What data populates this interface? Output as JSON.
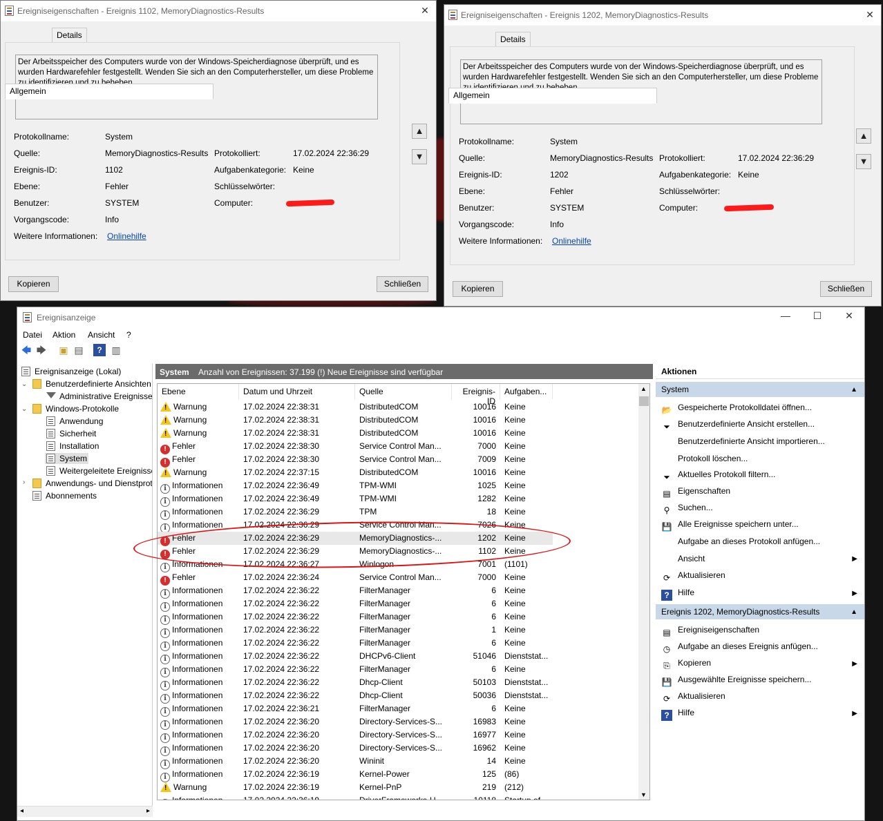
{
  "dialogs": [
    {
      "title": "Ereigniseigenschaften - Ereignis 1102, MemoryDiagnostics-Results",
      "tab_general": "Allgemein",
      "tab_details": "Details",
      "description": "Der Arbeitsspeicher des Computers wurde von der Windows-Speicherdiagnose überprüft, und es wurden Hardwarefehler festgestellt. Wenden Sie sich an den Computerhersteller, um diese Probleme zu identifizieren und zu beheben.",
      "fields": {
        "log_label": "Protokollname:",
        "log": "System",
        "source_label": "Quelle:",
        "source": "MemoryDiagnostics-Results",
        "logged_label": "Protokolliert:",
        "logged": "17.02.2024 22:36:29",
        "id_label": "Ereignis-ID:",
        "id": "1102",
        "task_label": "Aufgabenkategorie:",
        "task": "Keine",
        "level_label": "Ebene:",
        "level": "Fehler",
        "keywords_label": "Schlüsselwörter:",
        "user_label": "Benutzer:",
        "user": "SYSTEM",
        "computer_label": "Computer:",
        "opcode_label": "Vorgangscode:",
        "opcode": "Info",
        "more_label": "Weitere Informationen:",
        "more_link": "Onlinehilfe"
      },
      "copy": "Kopieren",
      "close": "Schließen"
    },
    {
      "title": "Ereigniseigenschaften - Ereignis 1202, MemoryDiagnostics-Results",
      "tab_general": "Allgemein",
      "tab_details": "Details",
      "description": "Der Arbeitsspeicher des Computers wurde von der Windows-Speicherdiagnose überprüft, und es wurden Hardwarefehler festgestellt. Wenden Sie sich an den Computerhersteller, um diese Probleme zu identifizieren und zu beheben.",
      "fields": {
        "log_label": "Protokollname:",
        "log": "System",
        "source_label": "Quelle:",
        "source": "MemoryDiagnostics-Results",
        "logged_label": "Protokolliert:",
        "logged": "17.02.2024 22:36:29",
        "id_label": "Ereignis-ID:",
        "id": "1202",
        "task_label": "Aufgabenkategorie:",
        "task": "Keine",
        "level_label": "Ebene:",
        "level": "Fehler",
        "keywords_label": "Schlüsselwörter:",
        "user_label": "Benutzer:",
        "user": "SYSTEM",
        "computer_label": "Computer:",
        "opcode_label": "Vorgangscode:",
        "opcode": "Info",
        "more_label": "Weitere Informationen:",
        "more_link": "Onlinehilfe"
      },
      "copy": "Kopieren",
      "close": "Schließen"
    }
  ],
  "main": {
    "title": "Ereignisanzeige",
    "menu": [
      "Datei",
      "Aktion",
      "Ansicht",
      "?"
    ],
    "tree": [
      "Ereignisanzeige (Lokal)",
      "Benutzerdefinierte Ansichten",
      "Administrative Ereignisse",
      "Windows-Protokolle",
      "Anwendung",
      "Sicherheit",
      "Installation",
      "System",
      "Weitergeleitete Ereignisse",
      "Anwendungs- und Dienstprotokolle",
      "Abonnements"
    ],
    "header_name": "System",
    "header_info": "Anzahl von Ereignissen: 37.199 (!) Neue Ereignisse sind verfügbar",
    "columns": [
      "Ebene",
      "Datum und Uhrzeit",
      "Quelle",
      "Ereignis-ID",
      "Aufgaben..."
    ],
    "rows": [
      [
        "w",
        "Warnung",
        "17.02.2024 22:38:31",
        "DistributedCOM",
        "10016",
        "Keine"
      ],
      [
        "w",
        "Warnung",
        "17.02.2024 22:38:31",
        "DistributedCOM",
        "10016",
        "Keine"
      ],
      [
        "w",
        "Warnung",
        "17.02.2024 22:38:31",
        "DistributedCOM",
        "10016",
        "Keine"
      ],
      [
        "e",
        "Fehler",
        "17.02.2024 22:38:30",
        "Service Control Man...",
        "7000",
        "Keine"
      ],
      [
        "e",
        "Fehler",
        "17.02.2024 22:38:30",
        "Service Control Man...",
        "7009",
        "Keine"
      ],
      [
        "w",
        "Warnung",
        "17.02.2024 22:37:15",
        "DistributedCOM",
        "10016",
        "Keine"
      ],
      [
        "i",
        "Informationen",
        "17.02.2024 22:36:49",
        "TPM-WMI",
        "1025",
        "Keine"
      ],
      [
        "i",
        "Informationen",
        "17.02.2024 22:36:49",
        "TPM-WMI",
        "1282",
        "Keine"
      ],
      [
        "i",
        "Informationen",
        "17.02.2024 22:36:29",
        "TPM",
        "18",
        "Keine"
      ],
      [
        "i",
        "Informationen",
        "17.02.2024 22:36:29",
        "Service Control Man...",
        "7026",
        "Keine"
      ],
      [
        "e",
        "Fehler",
        "17.02.2024 22:36:29",
        "MemoryDiagnostics-...",
        "1202",
        "Keine"
      ],
      [
        "e",
        "Fehler",
        "17.02.2024 22:36:29",
        "MemoryDiagnostics-...",
        "1102",
        "Keine"
      ],
      [
        "i",
        "Informationen",
        "17.02.2024 22:36:27",
        "Winlogon",
        "7001",
        "(1101)"
      ],
      [
        "e",
        "Fehler",
        "17.02.2024 22:36:24",
        "Service Control Man...",
        "7000",
        "Keine"
      ],
      [
        "i",
        "Informationen",
        "17.02.2024 22:36:22",
        "FilterManager",
        "6",
        "Keine"
      ],
      [
        "i",
        "Informationen",
        "17.02.2024 22:36:22",
        "FilterManager",
        "6",
        "Keine"
      ],
      [
        "i",
        "Informationen",
        "17.02.2024 22:36:22",
        "FilterManager",
        "6",
        "Keine"
      ],
      [
        "i",
        "Informationen",
        "17.02.2024 22:36:22",
        "FilterManager",
        "1",
        "Keine"
      ],
      [
        "i",
        "Informationen",
        "17.02.2024 22:36:22",
        "FilterManager",
        "6",
        "Keine"
      ],
      [
        "i",
        "Informationen",
        "17.02.2024 22:36:22",
        "DHCPv6-Client",
        "51046",
        "Dienststat..."
      ],
      [
        "i",
        "Informationen",
        "17.02.2024 22:36:22",
        "FilterManager",
        "6",
        "Keine"
      ],
      [
        "i",
        "Informationen",
        "17.02.2024 22:36:22",
        "Dhcp-Client",
        "50103",
        "Dienststat..."
      ],
      [
        "i",
        "Informationen",
        "17.02.2024 22:36:22",
        "Dhcp-Client",
        "50036",
        "Dienststat..."
      ],
      [
        "i",
        "Informationen",
        "17.02.2024 22:36:21",
        "FilterManager",
        "6",
        "Keine"
      ],
      [
        "i",
        "Informationen",
        "17.02.2024 22:36:20",
        "Directory-Services-S...",
        "16983",
        "Keine"
      ],
      [
        "i",
        "Informationen",
        "17.02.2024 22:36:20",
        "Directory-Services-S...",
        "16977",
        "Keine"
      ],
      [
        "i",
        "Informationen",
        "17.02.2024 22:36:20",
        "Directory-Services-S...",
        "16962",
        "Keine"
      ],
      [
        "i",
        "Informationen",
        "17.02.2024 22:36:20",
        "Wininit",
        "14",
        "Keine"
      ],
      [
        "i",
        "Informationen",
        "17.02.2024 22:36:19",
        "Kernel-Power",
        "125",
        "(86)"
      ],
      [
        "w",
        "Warnung",
        "17.02.2024 22:36:19",
        "Kernel-PnP",
        "219",
        "(212)"
      ],
      [
        "i",
        "Informationen",
        "17.02.2024 22:36:19",
        "DriverFrameworks-U...",
        "10118",
        "Startup of..."
      ]
    ],
    "actions_title": "Aktionen",
    "actions_section1": "System",
    "actions1": [
      "Gespeicherte Protokolldatei öffnen...",
      "Benutzerdefinierte Ansicht erstellen...",
      "Benutzerdefinierte Ansicht importieren...",
      "Protokoll löschen...",
      "Aktuelles Protokoll filtern...",
      "Eigenschaften",
      "Suchen...",
      "Alle Ereignisse speichern unter...",
      "Aufgabe an dieses Protokoll anfügen...",
      "Ansicht",
      "Aktualisieren",
      "Hilfe"
    ],
    "actions_section2": "Ereignis 1202, MemoryDiagnostics-Results",
    "actions2": [
      "Ereigniseigenschaften",
      "Aufgabe an dieses Ereignis anfügen...",
      "Kopieren",
      "Ausgewählte Ereignisse speichern...",
      "Aktualisieren",
      "Hilfe"
    ]
  }
}
